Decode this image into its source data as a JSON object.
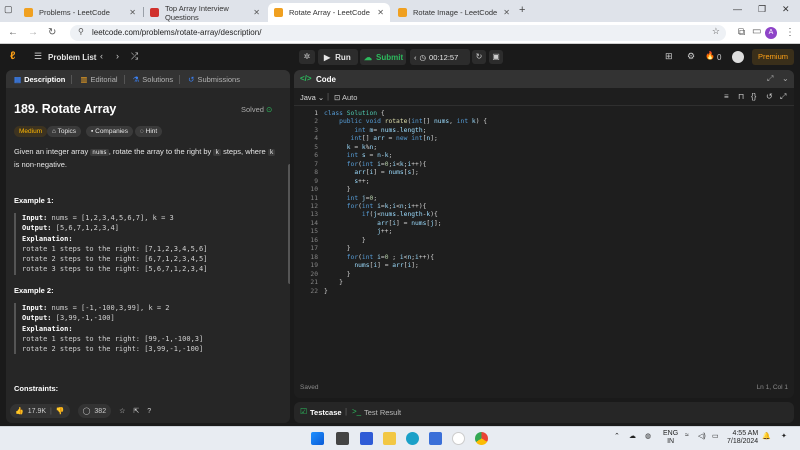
{
  "browser": {
    "tabs": [
      {
        "title": "Problems - LeetCode",
        "active": false
      },
      {
        "title": "Top Array Interview Questions",
        "active": false
      },
      {
        "title": "Rotate Array - LeetCode",
        "active": true
      },
      {
        "title": "Rotate Image - LeetCode",
        "active": false
      }
    ],
    "url": "leetcode.com/problems/rotate-array/description/",
    "profile_initial": "A"
  },
  "nav": {
    "problem_list": "Problem List",
    "run": "Run",
    "submit": "Submit",
    "timer": "00:12:57",
    "streak": "0",
    "premium": "Premium"
  },
  "left_tabs": [
    "Description",
    "Editorial",
    "Solutions",
    "Submissions"
  ],
  "problem": {
    "title": "189. Rotate Array",
    "status": "Solved",
    "difficulty": "Medium",
    "chips": [
      "Topics",
      "Companies",
      "Hint"
    ],
    "desc_parts": [
      "Given an integer array ",
      "nums",
      ", rotate the array to the right by ",
      "k",
      " steps, where ",
      "k",
      " is non-negative."
    ],
    "example1_heading": "Example 1:",
    "example1": {
      "input_label": "Input:",
      "input": "nums = [1,2,3,4,5,6,7], k = 3",
      "output_label": "Output:",
      "output": "[5,6,7,1,2,3,4]",
      "explanation_label": "Explanation:",
      "lines": [
        "rotate 1 steps to the right: [7,1,2,3,4,5,6]",
        "rotate 2 steps to the right: [6,7,1,2,3,4,5]",
        "rotate 3 steps to the right: [5,6,7,1,2,3,4]"
      ]
    },
    "example2_heading": "Example 2:",
    "example2": {
      "input_label": "Input:",
      "input": "nums = [-1,-100,3,99], k = 2",
      "output_label": "Output:",
      "output": "[3,99,-1,-100]",
      "explanation_label": "Explanation:",
      "lines": [
        "rotate 1 steps to the right: [99,-1,-100,3]",
        "rotate 2 steps to the right: [3,99,-1,-100]"
      ]
    },
    "constraints_heading": "Constraints:",
    "likes": "17.9K",
    "comments": "382"
  },
  "editor": {
    "header": "Code",
    "language": "Java",
    "mode": "Auto",
    "status": "Saved",
    "cursor": "Ln 1, Col 1",
    "line_numbers": [
      "1",
      "2",
      "3",
      "4",
      "5",
      "6",
      "7",
      "8",
      "9",
      "10",
      "11",
      "12",
      "13",
      "14",
      "15",
      "16",
      "17",
      "18",
      "19",
      "20",
      "21",
      "22"
    ]
  },
  "bottom": {
    "testcase": "Testcase",
    "test_result": "Test Result"
  },
  "taskbar": {
    "lang": "ENG",
    "region": "IN",
    "time": "4:55 AM",
    "date": "7/18/2024"
  }
}
